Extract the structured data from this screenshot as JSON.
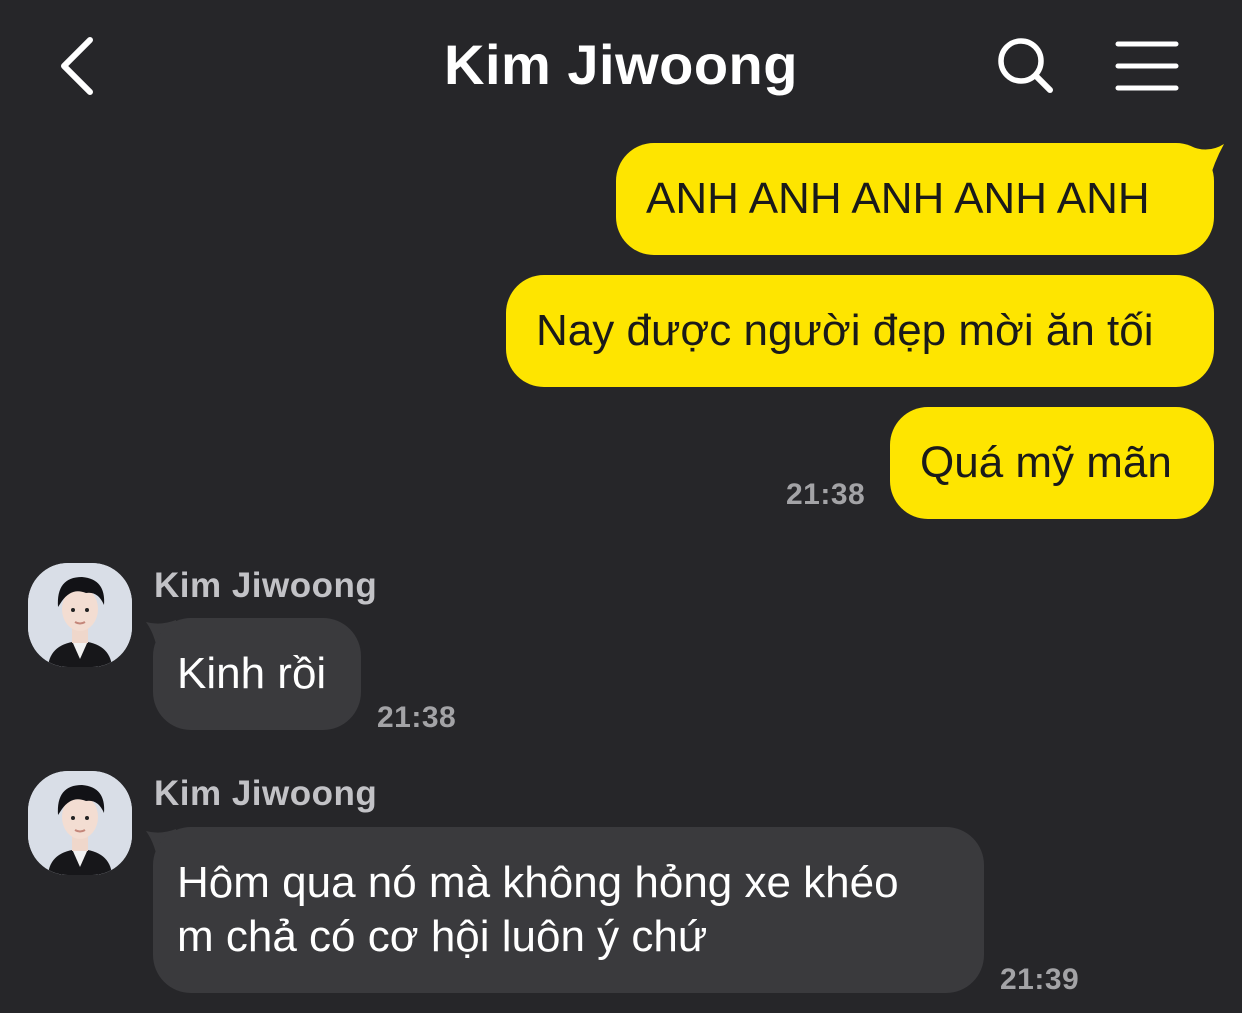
{
  "header": {
    "title": "Kim Jiwoong",
    "back_icon": "chevron-left-icon",
    "search_icon": "search-icon",
    "menu_icon": "hamburger-menu-icon"
  },
  "colors": {
    "background": "#262629",
    "outgoing_bubble": "#fee500",
    "incoming_bubble": "#3a3a3d",
    "timestamp": "#a3a3a6"
  },
  "outgoing": {
    "messages": [
      "ANH ANH ANH ANH ANH",
      "Nay được người đẹp mời ăn tối",
      "Quá mỹ mãn"
    ],
    "time": "21:38"
  },
  "incoming": [
    {
      "sender": "Kim Jiwoong",
      "text": "Kinh rồi",
      "time": "21:38"
    },
    {
      "sender": "Kim Jiwoong",
      "text": "Hôm qua nó mà không hỏng xe khéo\nm chả có cơ hội luôn ý chứ",
      "time": "21:39"
    }
  ]
}
